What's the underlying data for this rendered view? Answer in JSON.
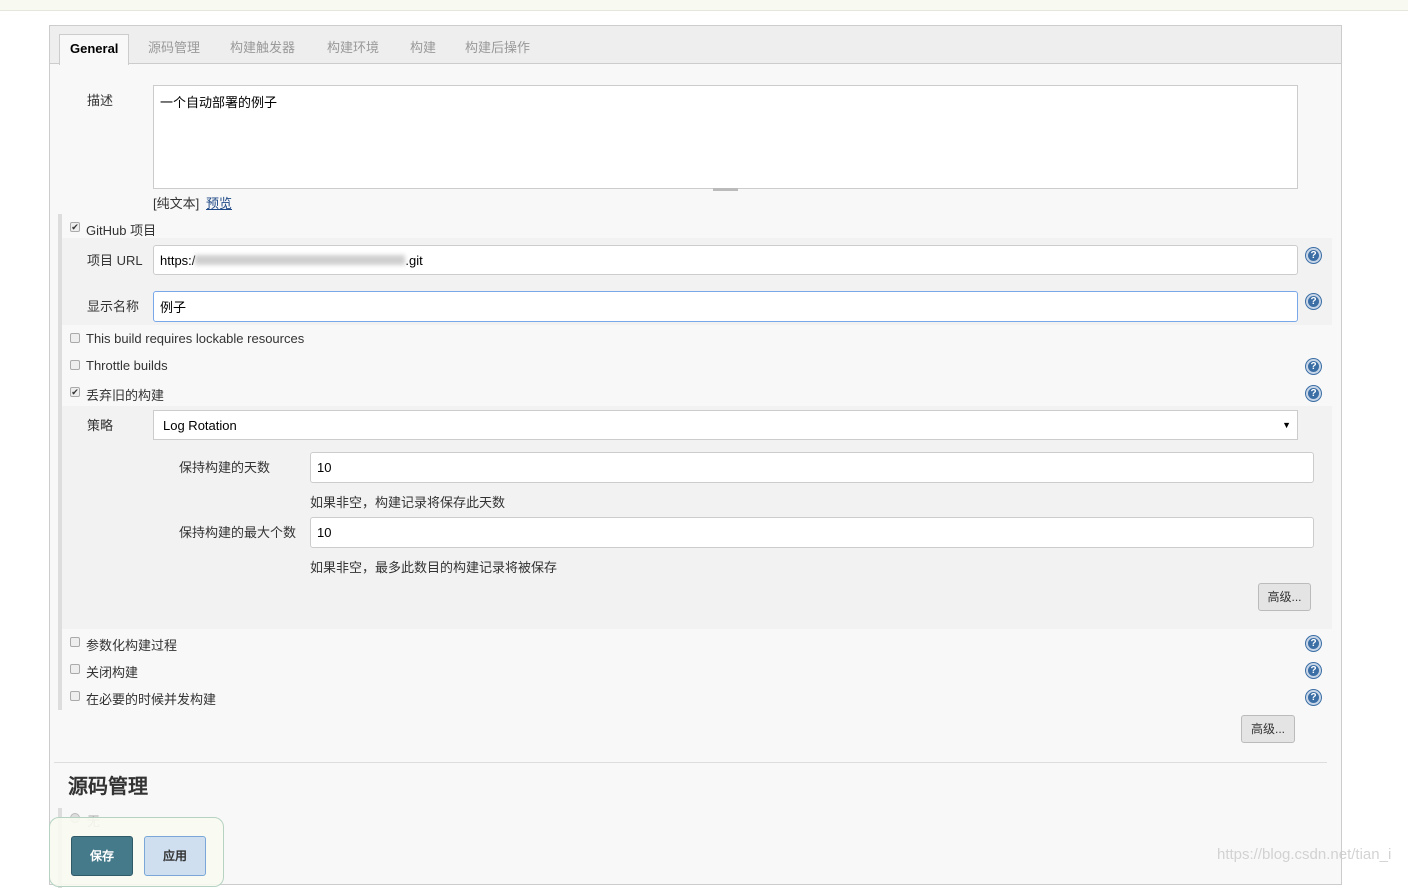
{
  "tabs": [
    "General",
    "源码管理",
    "构建触发器",
    "构建环境",
    "构建",
    "构建后操作"
  ],
  "description": {
    "label": "描述",
    "value": "一个自动部署的例子",
    "plain_text": "[纯文本]",
    "preview": "预览"
  },
  "github": {
    "label": "GitHub 项目",
    "checked": true,
    "url_label": "项目 URL",
    "url_prefix": "https:/",
    "url_suffix": ".git",
    "display_label": "显示名称",
    "display_value": "例子"
  },
  "options": {
    "lockable": "This build requires lockable resources",
    "throttle": "Throttle builds",
    "discard": "丢弃旧的构建"
  },
  "strategy": {
    "label": "策略",
    "value": "Log Rotation",
    "days_label": "保持构建的天数",
    "days_value": "10",
    "days_hint": "如果非空，构建记录将保存此天数",
    "max_label": "保持构建的最大个数",
    "max_value": "10",
    "max_hint": "如果非空，最多此数目的构建记录将被保存",
    "advanced": "高级..."
  },
  "more": {
    "parameterized": "参数化构建过程",
    "disable": "关闭构建",
    "concurrent": "在必要的时候并发构建",
    "advanced": "高级..."
  },
  "scm": {
    "title": "源码管理",
    "none": "无"
  },
  "buttons": {
    "save": "保存",
    "apply": "应用"
  },
  "watermark": "https://blog.csdn.net/tian_i",
  "colors": {
    "save": "#457a8a",
    "apply": "#cfdff0",
    "focus": "#7aa7e8",
    "help": "#3b6ea5"
  }
}
